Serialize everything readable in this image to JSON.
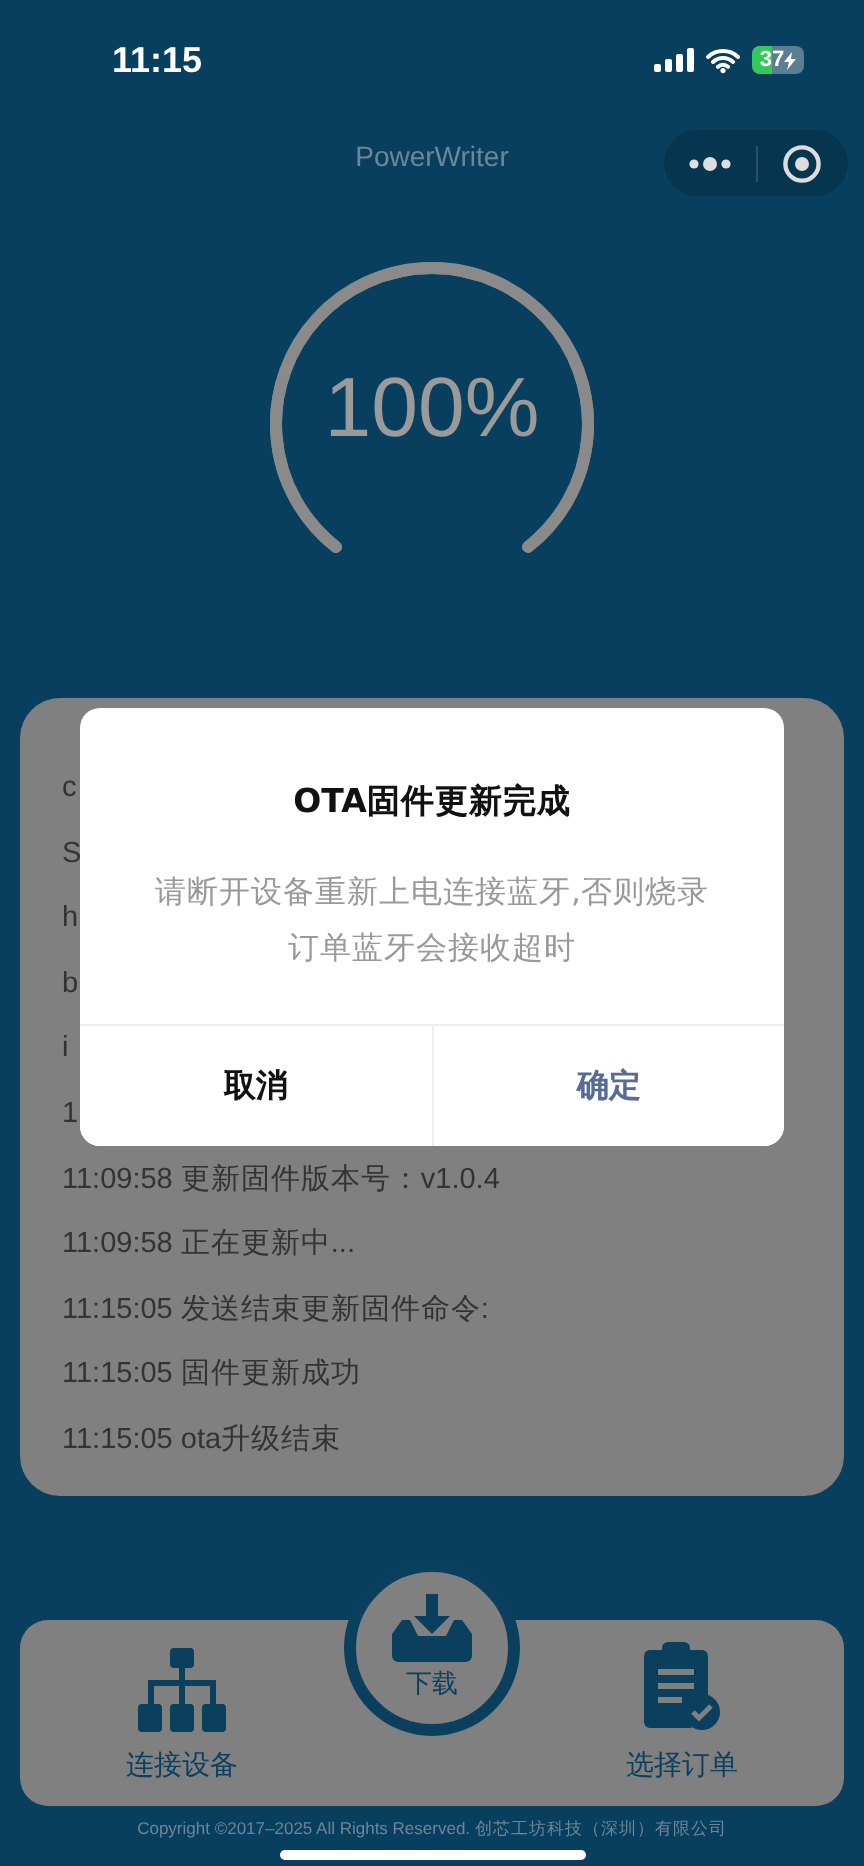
{
  "status_bar": {
    "time": "11:15",
    "battery": "37"
  },
  "header": {
    "title": "PowerWriter"
  },
  "progress": {
    "level": 1,
    "label": "100%"
  },
  "log": {
    "lines": [
      "c",
      "S",
      "h",
      "b",
      "i",
      "1",
      "11:09:58 更新固件版本号：v1.0.4",
      "11:09:58 正在更新中...",
      "11:15:05 发送结束更新固件命令:",
      "11:15:05 固件更新成功",
      "11:15:05 ota升级结束"
    ]
  },
  "dialog": {
    "title": "OTA固件更新完成",
    "message": "请断开设备重新上电连接蓝牙,否则烧录订单蓝牙会接收超时",
    "buttons": [
      {
        "label": "取消",
        "kind": "cancel"
      },
      {
        "label": "确定",
        "kind": "confirm"
      }
    ]
  },
  "bottom_nav": {
    "items": [
      {
        "label": "连接设备",
        "kind": "network"
      },
      {
        "label": "下载",
        "kind": "download"
      },
      {
        "label": "选择订单",
        "kind": "order"
      }
    ]
  },
  "footer": {
    "copyright": "Copyright ©2017–2025 All Rights Reserved. 创芯工坊科技（深圳）有限公司"
  }
}
